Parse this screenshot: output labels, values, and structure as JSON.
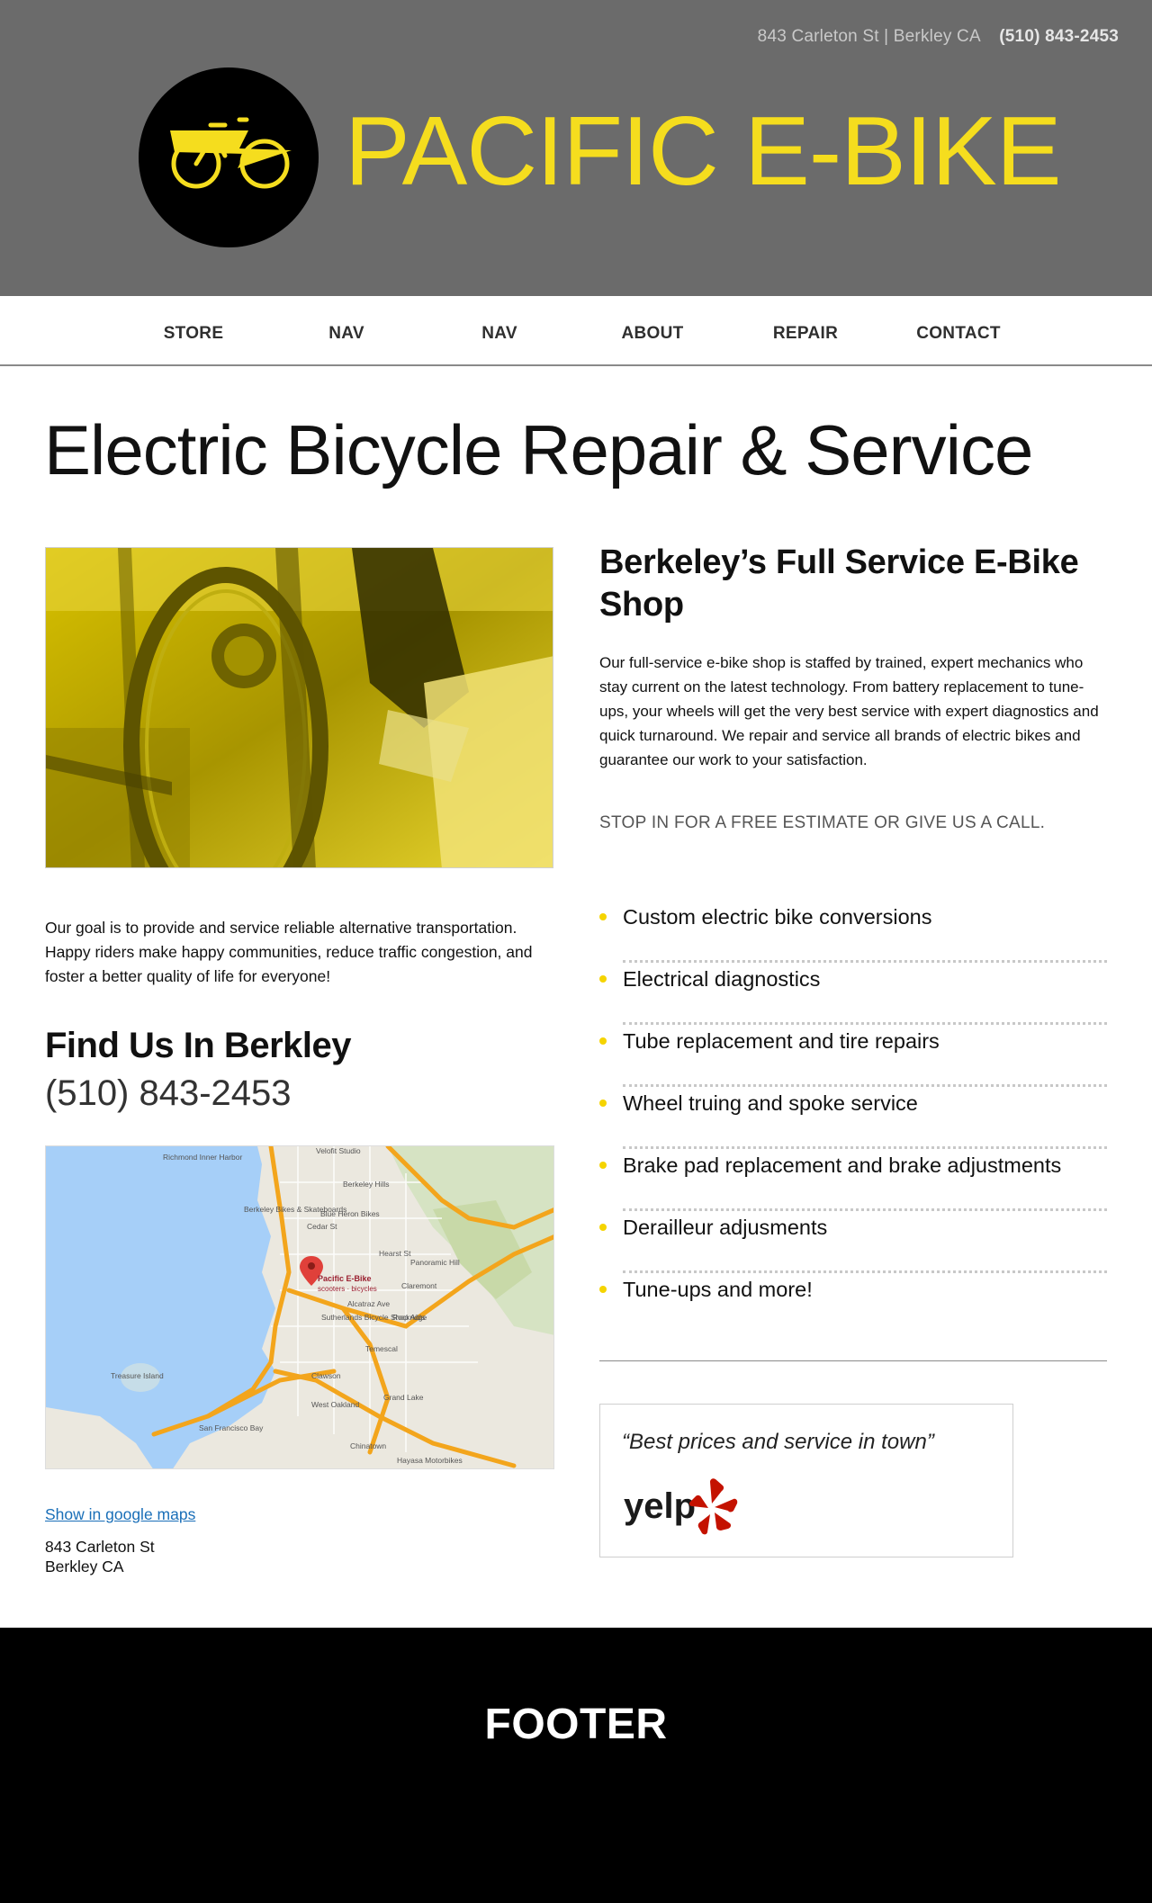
{
  "header": {
    "address": "843 Carleton St | Berkley CA",
    "phone": "(510) 843-2453",
    "brand": "PACIFIC E-BIKE",
    "colors": {
      "background": "#6b6b6b",
      "accent": "#f5dd1e"
    }
  },
  "nav": {
    "items": [
      {
        "label": "STORE"
      },
      {
        "label": "NAV"
      },
      {
        "label": "NAV"
      },
      {
        "label": "ABOUT"
      },
      {
        "label": "REPAIR"
      },
      {
        "label": "CONTACT"
      }
    ]
  },
  "main": {
    "title": "Electric Bicycle Repair & Service",
    "goal_text": "Our goal is to provide and service reliable alternative transportation. Happy riders make happy communities, reduce traffic congestion, and foster a better quality of life for everyone!",
    "find": {
      "title": "Find Us In Berkley",
      "phone": "(510) 843-2453",
      "maps_link": "Show in google maps",
      "address_line1": "843 Carleton St",
      "address_line2": "Berkley CA"
    },
    "map_labels": {
      "richmond": "Richmond Inner Harbor",
      "velofit": "Velofit Studio",
      "berkeley_hills": "Berkeley Hills",
      "berkeley_bikes": "Berkeley Bikes & Skateboards",
      "blue_heron": "Blue Heron Bikes",
      "cedar": "Cedar St",
      "hearst": "Hearst St",
      "pin_title": "Pacific E-Bike",
      "pin_sub": "scooters · bicycles",
      "panoramic": "Panoramic Hill",
      "claremont": "Claremont",
      "alcatraz": "Alcatraz Ave",
      "sutherlands": "Sutherlands Bicycle Shop Aids",
      "rockridge": "Rockridge",
      "temescal": "Temescal",
      "treasure": "Treasure Island",
      "clawson": "Clawson",
      "west_oakland": "West Oakland",
      "grand_lake": "Grand Lake",
      "sf_bay": "San Francisco Bay",
      "chinatown": "Chinatown",
      "hayasa": "Hayasa Motorbikes"
    },
    "shop": {
      "title": "Berkeley’s Full Service E-Bike Shop",
      "description": "Our full-service e-bike shop is staffed by trained, expert mechanics who stay current on the latest technology. From battery replacement to tune-ups, your wheels will get the very best service with expert diagnostics and quick turnaround. We repair and service all brands of electric bikes and guarantee our work to your satisfaction.",
      "cta": "STOP IN FOR A FREE ESTIMATE OR GIVE US A CALL."
    },
    "services": [
      "Custom electric bike conversions",
      "Electrical diagnostics",
      "Tube replacement and tire repairs",
      "Wheel truing and spoke service",
      "Brake pad replacement and brake adjustments",
      "Derailleur adjusments",
      "Tune-ups and more!"
    ],
    "review": {
      "quote": "“Best prices and service in town”",
      "source": "yelp"
    }
  },
  "footer": {
    "label": "FOOTER"
  }
}
